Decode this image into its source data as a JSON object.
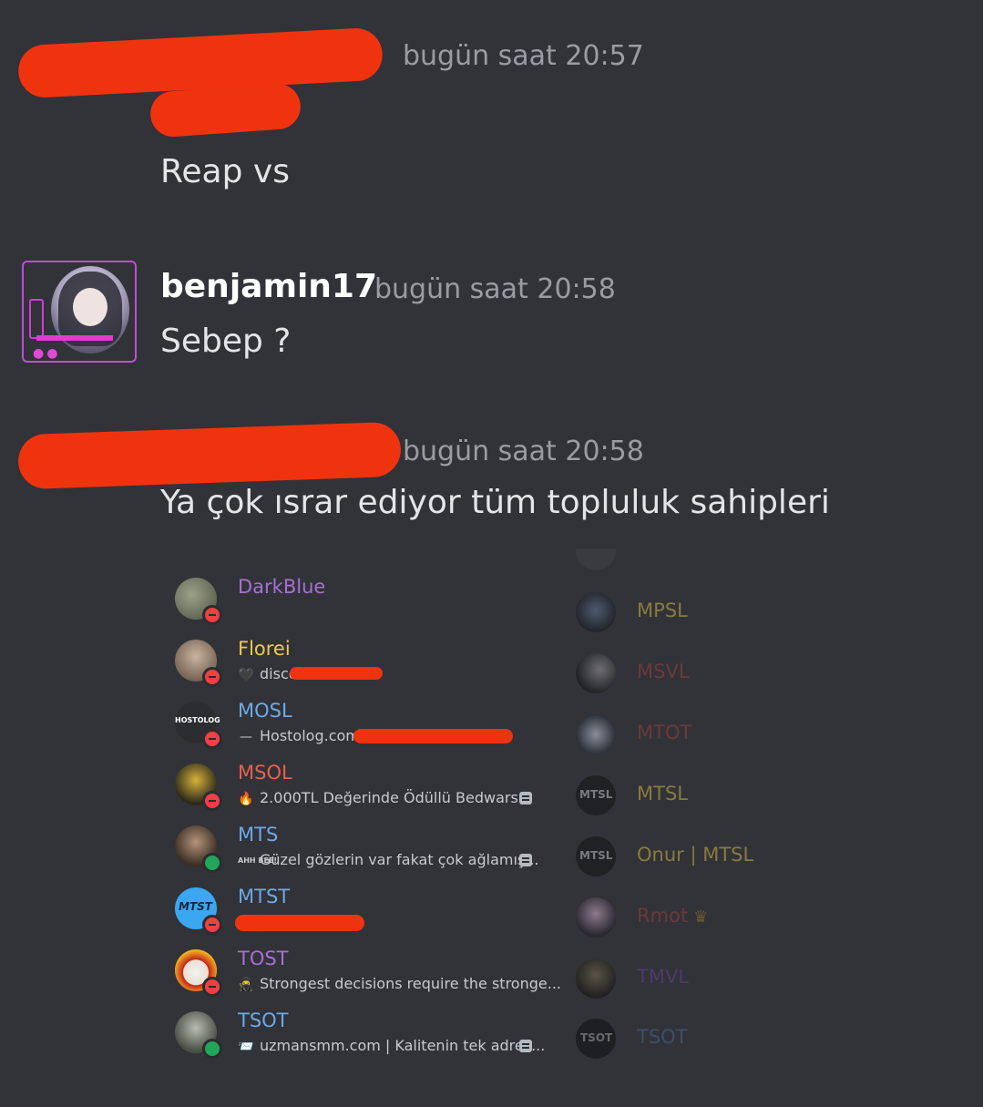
{
  "colors": {
    "background": "#313338",
    "timestamp": "#9a9ca3",
    "redaction": "#f0330f",
    "status_dnd": "#f23f43",
    "status_online": "#23a55a"
  },
  "messages": [
    {
      "author": "",
      "time": "bugün saat 20:57",
      "text": "Reap vs",
      "author_redacted": true
    },
    {
      "author": "benjamin17",
      "time": "bugün saat 20:58",
      "text": "Sebep ?",
      "author_redacted": false
    },
    {
      "author": "",
      "time": "bugün saat 20:58",
      "text": "Ya çok ısrar ediyor tüm topluluk sahipleri",
      "author_redacted": true
    }
  ],
  "member_list_left": [
    {
      "name": "DarkBlue",
      "name_color": "#a86ed6",
      "status": "dnd",
      "custom_status": "",
      "emoji": ""
    },
    {
      "name": "Florei",
      "name_color": "#f0c94a",
      "status": "dnd",
      "custom_status": "discor",
      "emoji": "🖤"
    },
    {
      "name": "MOSL",
      "name_color": "#6ea9e8",
      "status": "dnd",
      "custom_status": "Hostolog.com",
      "emoji": "—",
      "avatar_text": "HOSTOLOG"
    },
    {
      "name": "MSOL",
      "name_color": "#e8604c",
      "status": "dnd",
      "custom_status": "2.000TL Değerinde Ödüllü Bedwars...",
      "emoji": "🔥",
      "has_doc": true
    },
    {
      "name": "MTS",
      "name_color": "#6ea9e8",
      "status": "online",
      "custom_status": "Güzel gözlerin var fakat çok ağlamış...",
      "emoji": "AHH BEE!",
      "has_doc": true
    },
    {
      "name": "MTST",
      "name_color": "#6ea9e8",
      "status": "dnd",
      "custom_status": "",
      "emoji": "",
      "avatar_text": "MTST"
    },
    {
      "name": "TOST",
      "name_color": "#a86ed6",
      "status": "dnd",
      "custom_status": "Strongest decisions require the stronge...",
      "emoji": "🥷"
    },
    {
      "name": "TSOT",
      "name_color": "#6ea9e8",
      "status": "online",
      "custom_status": "uzmansmm.com | Kalitenin tek adres...",
      "emoji": "📨",
      "has_doc": true
    }
  ],
  "member_list_right": [
    {
      "name": "MPSL",
      "name_color": "#8a7a3e"
    },
    {
      "name": "MSVL",
      "name_color": "#6a3a38"
    },
    {
      "name": "MTOT",
      "name_color": "#6a3a38"
    },
    {
      "name": "MTSL",
      "name_color": "#8a7a3e",
      "avatar_text": "MTSL"
    },
    {
      "name": "Onur | MTSL",
      "name_color": "#8a7a3e",
      "avatar_text": "MTSL"
    },
    {
      "name": "Rmot",
      "name_color": "#6a3a38",
      "crown": "♛"
    },
    {
      "name": "TMVL",
      "name_color": "#4e3a6a"
    },
    {
      "name": "TSOT",
      "name_color": "#3e4e6a",
      "avatar_text": "TSOT"
    }
  ]
}
